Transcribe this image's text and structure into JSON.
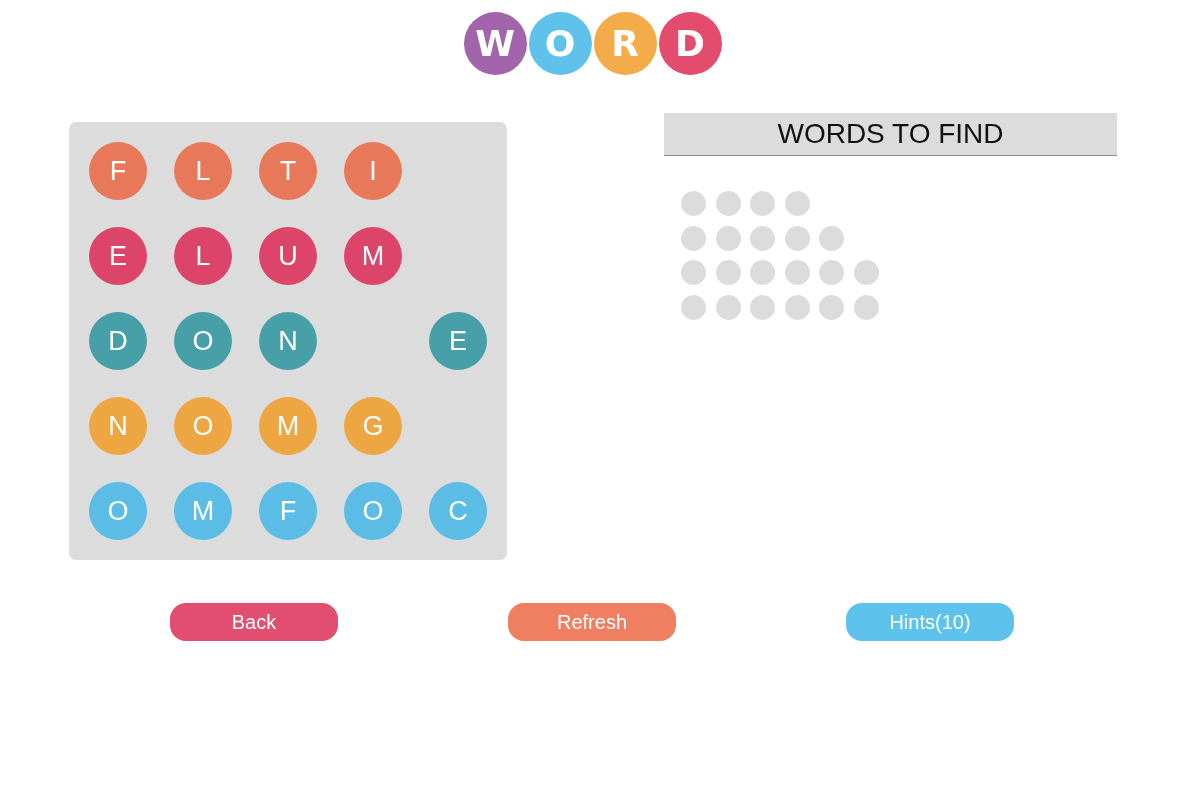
{
  "logo": {
    "letters": [
      {
        "letter": "W",
        "color": "#a265ac"
      },
      {
        "letter": "O",
        "color": "#5ec2ea"
      },
      {
        "letter": "R",
        "color": "#f4ab4a"
      },
      {
        "letter": "D",
        "color": "#e44c6d"
      }
    ]
  },
  "grid": {
    "rows": [
      {
        "color": "#e8785a",
        "cells": [
          {
            "kind": "tile",
            "letter": "F"
          },
          {
            "kind": "tile",
            "letter": "L"
          },
          {
            "kind": "tile",
            "letter": "T"
          },
          {
            "kind": "tile",
            "letter": "I"
          },
          {
            "kind": "blank"
          }
        ]
      },
      {
        "color": "#dc4569",
        "cells": [
          {
            "kind": "tile",
            "letter": "E"
          },
          {
            "kind": "tile",
            "letter": "L"
          },
          {
            "kind": "tile",
            "letter": "U"
          },
          {
            "kind": "tile",
            "letter": "M"
          },
          {
            "kind": "blank"
          }
        ]
      },
      {
        "color": "#47a0a8",
        "cells": [
          {
            "kind": "tile",
            "letter": "D"
          },
          {
            "kind": "tile",
            "letter": "O"
          },
          {
            "kind": "tile",
            "letter": "N"
          },
          {
            "kind": "blank"
          },
          {
            "kind": "tile",
            "letter": "E"
          }
        ]
      },
      {
        "color": "#eea643",
        "cells": [
          {
            "kind": "tile",
            "letter": "N"
          },
          {
            "kind": "tile",
            "letter": "O"
          },
          {
            "kind": "tile",
            "letter": "M"
          },
          {
            "kind": "tile",
            "letter": "G"
          },
          {
            "kind": "blank"
          }
        ]
      },
      {
        "color": "#5bbde6",
        "cells": [
          {
            "kind": "tile",
            "letter": "O"
          },
          {
            "kind": "tile",
            "letter": "M"
          },
          {
            "kind": "tile",
            "letter": "F"
          },
          {
            "kind": "tile",
            "letter": "O"
          },
          {
            "kind": "tile",
            "letter": "C"
          }
        ]
      }
    ]
  },
  "words_panel": {
    "title": "WORDS TO FIND",
    "words": [
      {
        "slots": [
          {
            "filled": false
          },
          {
            "filled": false
          },
          {
            "filled": false
          },
          {
            "filled": false
          }
        ]
      },
      {
        "slots": [
          {
            "filled": false
          },
          {
            "filled": false
          },
          {
            "filled": false
          },
          {
            "filled": false
          },
          {
            "filled": false
          }
        ]
      },
      {
        "slots": [
          {
            "filled": false
          },
          {
            "filled": false
          },
          {
            "filled": false
          },
          {
            "filled": false
          },
          {
            "filled": false
          },
          {
            "filled": false
          }
        ]
      },
      {
        "slots": [
          {
            "filled": false
          },
          {
            "filled": false
          },
          {
            "filled": false
          },
          {
            "filled": false
          },
          {
            "filled": false
          },
          {
            "filled": false
          }
        ]
      }
    ]
  },
  "buttons": [
    {
      "label": "Back",
      "color": "#e24e6f"
    },
    {
      "label": "Refresh",
      "color": "#f07f62"
    },
    {
      "label": "Hints(10)",
      "color": "#5ec3ec"
    }
  ]
}
